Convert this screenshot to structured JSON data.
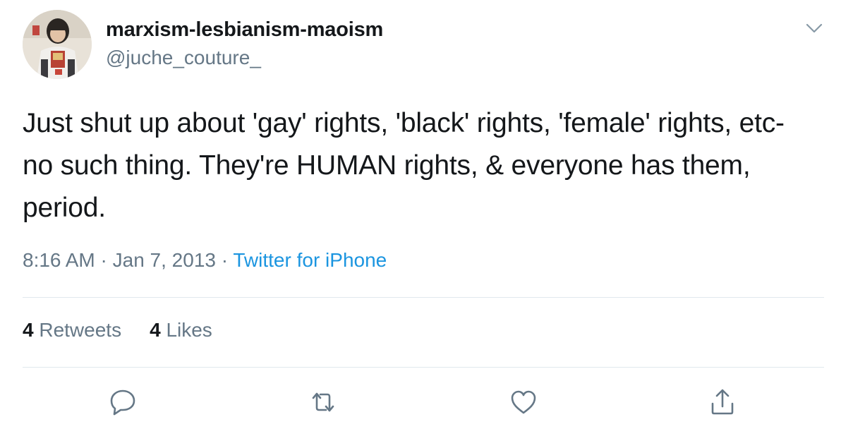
{
  "user": {
    "display_name": "marxism-lesbianism-maoism",
    "handle": "@juche_couture_"
  },
  "tweet": {
    "text": "Just shut up about 'gay' rights, 'black' rights, 'female' rights, etc-no such thing. They're HUMAN rights, & everyone has them, period.",
    "time": "8:16 AM",
    "separator": "·",
    "date": "Jan 7, 2013",
    "source": "Twitter for iPhone"
  },
  "stats": {
    "retweets_count": "4",
    "retweets_label": "Retweets",
    "likes_count": "4",
    "likes_label": "Likes"
  },
  "icons": {
    "caret": "chevron-down-icon",
    "reply": "reply-icon",
    "retweet": "retweet-icon",
    "like": "heart-icon",
    "share": "share-icon"
  },
  "colors": {
    "text_primary": "#14171a",
    "text_secondary": "#657786",
    "link": "#1b95e0",
    "divider": "#e1e8ed"
  }
}
